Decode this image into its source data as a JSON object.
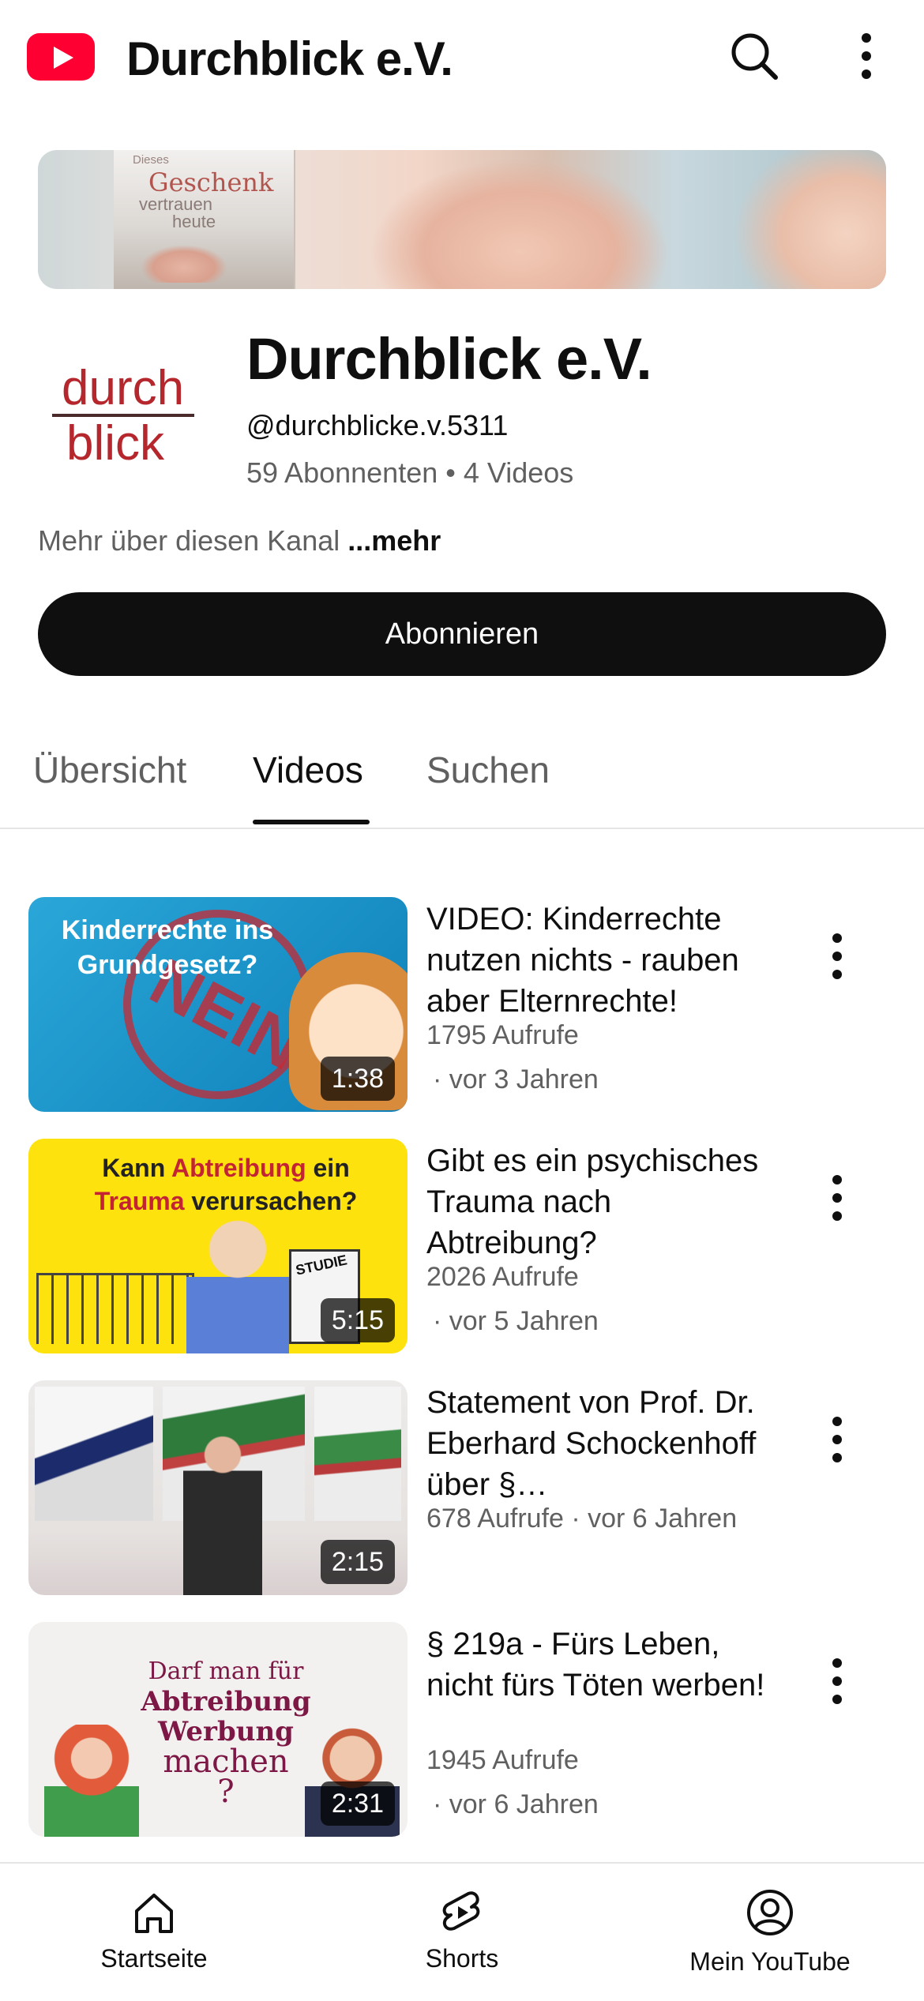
{
  "header": {
    "title": "Durchblick e.V.",
    "logo_icon": "youtube-logo-icon",
    "search_icon": "search-icon",
    "menu_icon": "more-vertical-icon"
  },
  "banner": {
    "line1": "Dieses",
    "line2": "Geschenk",
    "line3": "vertrauen",
    "line4": "heute"
  },
  "channel": {
    "avatar_line1": "durch",
    "avatar_line2": "blick",
    "name": "Durchblick e.V.",
    "handle": "@durchblicke.v.5311",
    "stats": "59 Abonnenten • 4 Videos",
    "about": "Mehr über diesen Kanal",
    "about_more": "...mehr",
    "subscribe_label": "Abonnieren"
  },
  "tabs": [
    {
      "label": "Übersicht",
      "active": false
    },
    {
      "label": "Videos",
      "active": true
    },
    {
      "label": "Suchen",
      "active": false
    }
  ],
  "videos": [
    {
      "title": "VIDEO: Kinderrechte nutzen nichts - rauben aber Elternrechte!",
      "views": "1795 Aufrufe",
      "age": "· vor 3 Jahren",
      "duration": "1:38",
      "thumb_text": "Kinderrechte ins Grundgesetz?",
      "thumb_stamp": "NEIN"
    },
    {
      "title": "Gibt es ein psychisches Trauma nach Abtreibung?",
      "views": "2026 Aufrufe",
      "age": "· vor 5 Jahren",
      "duration": "5:15",
      "thumb_text_a": "Kann ",
      "thumb_text_b": "Abtreibung",
      "thumb_text_c": " ein",
      "thumb_text_d": "Trauma",
      "thumb_text_e": " verursachen?",
      "thumb_box": "STUDIE"
    },
    {
      "title": "Statement von Prof. Dr. Eberhard Schockenhoff über §…",
      "meta": "678 Aufrufe · vor 6 Jahren",
      "duration": "2:15"
    },
    {
      "title": "§ 219a - Fürs Leben, nicht fürs Töten werben!",
      "views": "1945 Aufrufe",
      "age": "· vor 6 Jahren",
      "duration": "2:31",
      "thumb_l1": "Darf man für",
      "thumb_l2": "Abtreibung",
      "thumb_l3": "Werbung",
      "thumb_l4": "machen",
      "thumb_l5": "?"
    }
  ],
  "bottom_nav": [
    {
      "label": "Startseite",
      "icon": "home-icon"
    },
    {
      "label": "Shorts",
      "icon": "shorts-icon"
    },
    {
      "label": "Mein YouTube",
      "icon": "account-icon"
    }
  ],
  "colors": {
    "brand_red": "#ff0033",
    "text_primary": "#0f0f0f",
    "text_secondary": "#606060"
  }
}
